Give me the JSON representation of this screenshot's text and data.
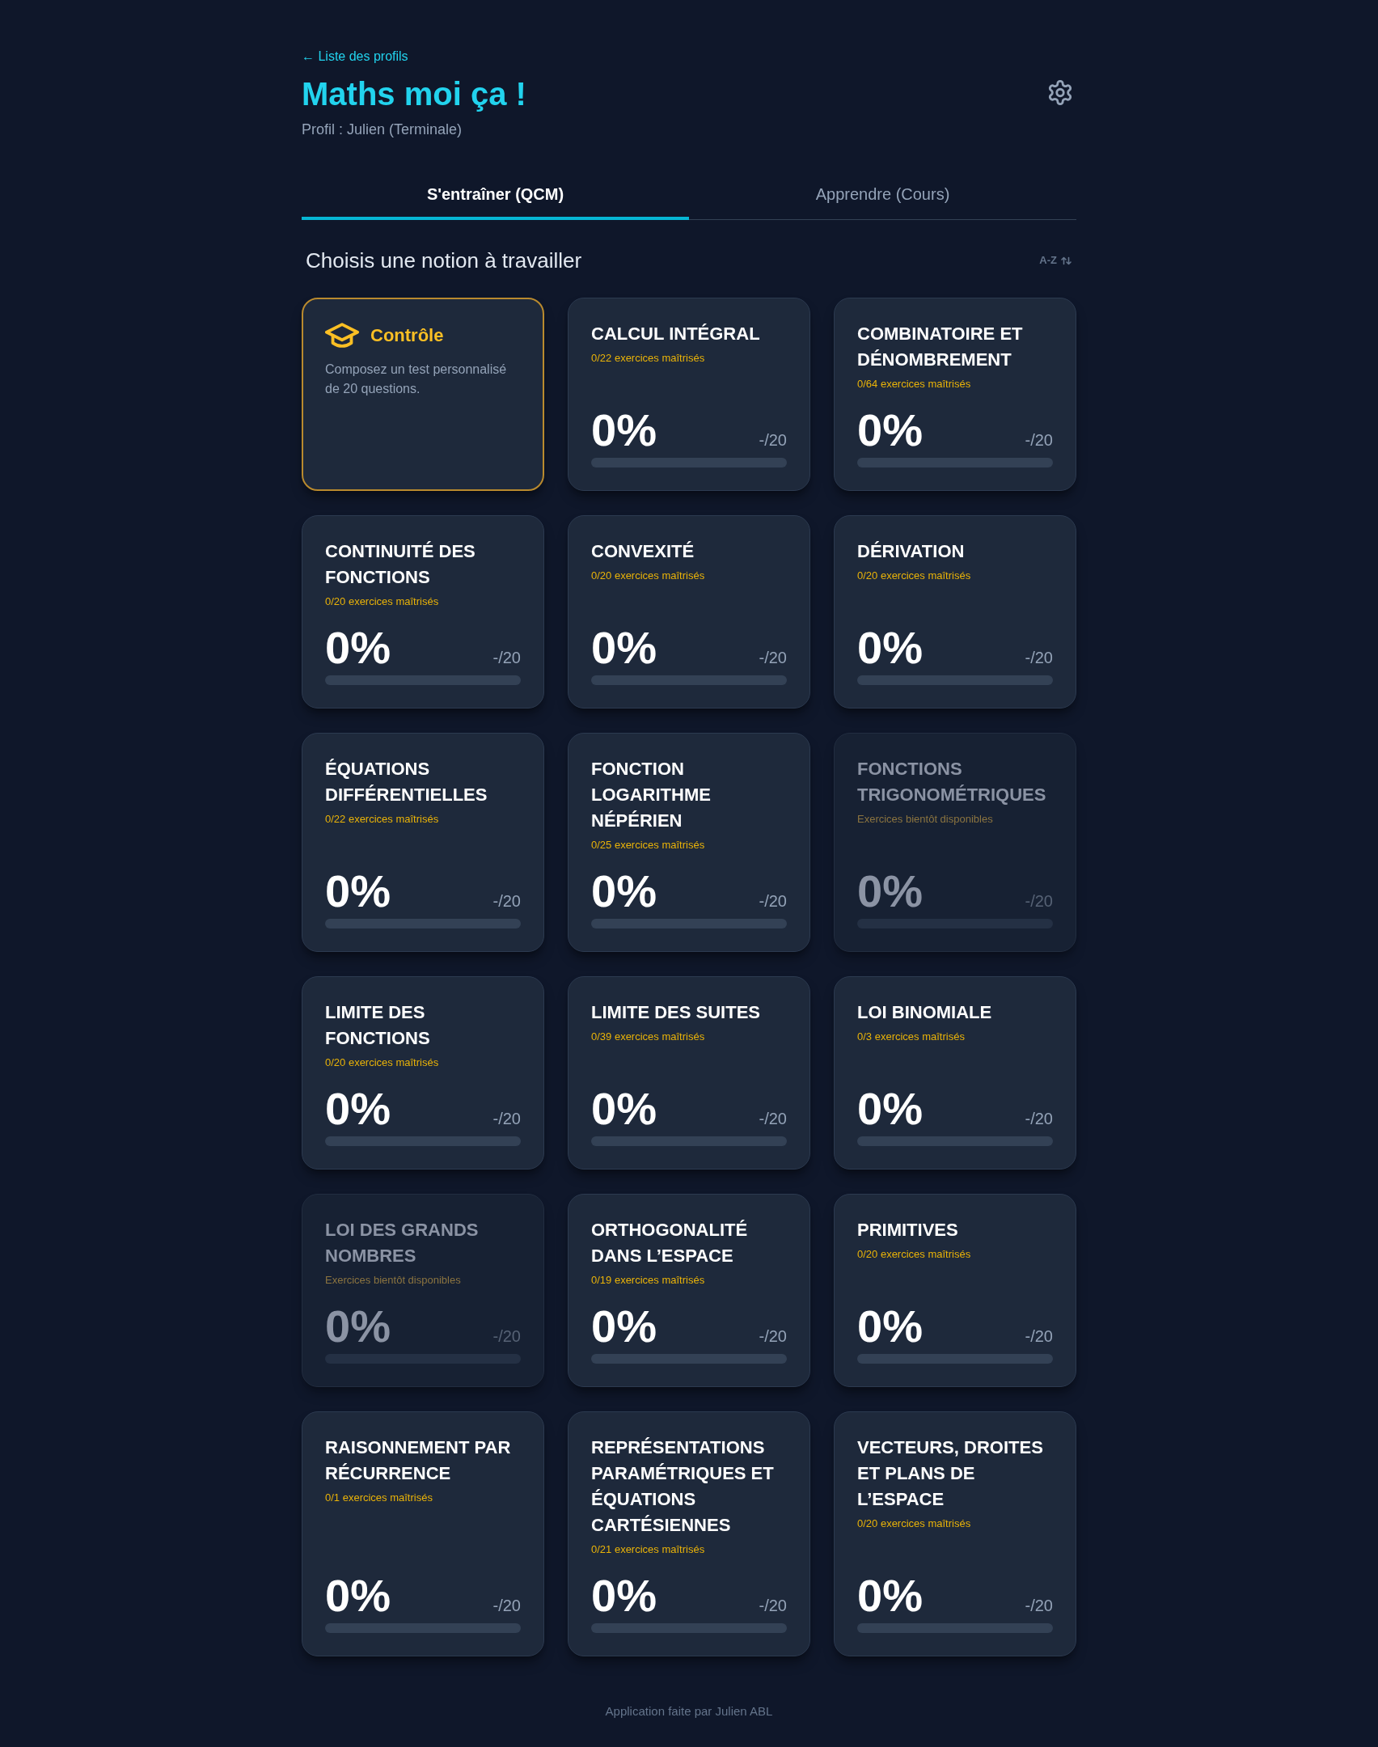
{
  "back_link": {
    "label": "← Liste des profils"
  },
  "app_title": "Maths moi ça !",
  "profile": "Profil : Julien (Terminale)",
  "tabs": [
    {
      "label": "S'entraîner (QCM)",
      "selected": true
    },
    {
      "label": "Apprendre (Cours)",
      "selected": false
    }
  ],
  "section": {
    "title": "Choisis une notion à travailler",
    "sort": {
      "label": "A-Z"
    }
  },
  "cards": [
    {
      "kind": "control",
      "title": "Contrôle",
      "description": "Composez un test personnalisé de 20 questions."
    },
    {
      "kind": "notion",
      "title": "CALCUL INTÉGRAL",
      "progress": "0/22 exercices maîtrisés",
      "percent": "0%",
      "score": "-/20",
      "level": 0,
      "disabled": false
    },
    {
      "kind": "notion",
      "title": "COMBINATOIRE ET DÉNOMBREMENT",
      "progress": "0/64 exercices maîtrisés",
      "percent": "0%",
      "score": "-/20",
      "level": 0,
      "disabled": false
    },
    {
      "kind": "notion",
      "title": "CONTINUITÉ DES FONCTIONS",
      "progress": "0/20 exercices maîtrisés",
      "percent": "0%",
      "score": "-/20",
      "level": 0,
      "disabled": false
    },
    {
      "kind": "notion",
      "title": "CONVEXITÉ",
      "progress": "0/20 exercices maîtrisés",
      "percent": "0%",
      "score": "-/20",
      "level": 0,
      "disabled": false
    },
    {
      "kind": "notion",
      "title": "DÉRIVATION",
      "progress": "0/20 exercices maîtrisés",
      "percent": "0%",
      "score": "-/20",
      "level": 0,
      "disabled": false
    },
    {
      "kind": "notion",
      "title": "ÉQUATIONS DIFFÉRENTIELLES",
      "progress": "0/22 exercices maîtrisés",
      "percent": "0%",
      "score": "-/20",
      "level": 0,
      "disabled": false
    },
    {
      "kind": "notion",
      "title": "FONCTION LOGARITHME NÉPÉRIEN",
      "progress": "0/25 exercices maîtrisés",
      "percent": "0%",
      "score": "-/20",
      "level": 0,
      "disabled": false
    },
    {
      "kind": "notion",
      "title": "FONCTIONS TRIGONOMÉTRIQUES",
      "progress": "Exercices bientôt disponibles",
      "percent": "0%",
      "score": "-/20",
      "level": 0,
      "disabled": true
    },
    {
      "kind": "notion",
      "title": "LIMITE DES FONCTIONS",
      "progress": "0/20 exercices maîtrisés",
      "percent": "0%",
      "score": "-/20",
      "level": 0,
      "disabled": false
    },
    {
      "kind": "notion",
      "title": "LIMITE DES SUITES",
      "progress": "0/39 exercices maîtrisés",
      "percent": "0%",
      "score": "-/20",
      "level": 0,
      "disabled": false
    },
    {
      "kind": "notion",
      "title": "LOI BINOMIALE",
      "progress": "0/3 exercices maîtrisés",
      "percent": "0%",
      "score": "-/20",
      "level": 0,
      "disabled": false
    },
    {
      "kind": "notion",
      "title": "LOI DES GRANDS NOMBRES",
      "progress": "Exercices bientôt disponibles",
      "percent": "0%",
      "score": "-/20",
      "level": 0,
      "disabled": true
    },
    {
      "kind": "notion",
      "title": "ORTHOGONALITÉ DANS L’ESPACE",
      "progress": "0/19 exercices maîtrisés",
      "percent": "0%",
      "score": "-/20",
      "level": 0,
      "disabled": false
    },
    {
      "kind": "notion",
      "title": "PRIMITIVES",
      "progress": "0/20 exercices maîtrisés",
      "percent": "0%",
      "score": "-/20",
      "level": 0,
      "disabled": false
    },
    {
      "kind": "notion",
      "title": "RAISONNEMENT PAR RÉCURRENCE",
      "progress": "0/1 exercices maîtrisés",
      "percent": "0%",
      "score": "-/20",
      "level": 0,
      "disabled": false
    },
    {
      "kind": "notion",
      "title": "REPRÉSENTATIONS PARAMÉTRIQUES ET ÉQUATIONS CARTÉSIENNES",
      "progress": "0/21 exercices maîtrisés",
      "percent": "0%",
      "score": "-/20",
      "level": 0,
      "disabled": false
    },
    {
      "kind": "notion",
      "title": "VECTEURS, DROITES ET PLANS DE L’ESPACE",
      "progress": "0/20 exercices maîtrisés",
      "percent": "0%",
      "score": "-/20",
      "level": 0,
      "disabled": false
    }
  ],
  "footer": "Application faite par Julien ABL"
}
